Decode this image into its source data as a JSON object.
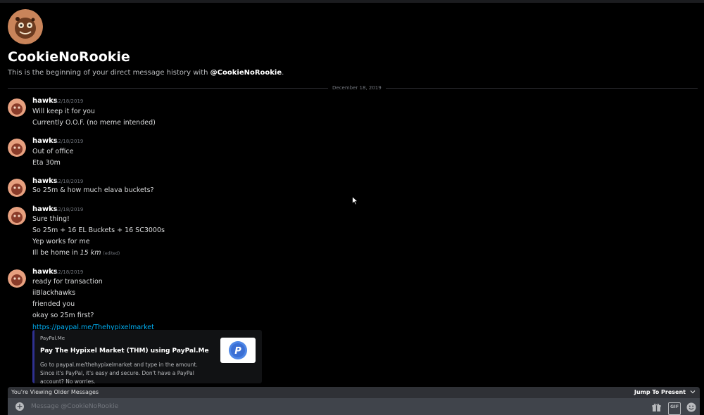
{
  "channel": {
    "name": "CookieNoRookie",
    "intro_prefix": "This is the beginning of your direct message history with ",
    "intro_mention": "@CookieNoRookie",
    "intro_suffix": "."
  },
  "date_divider": "December 18, 2019",
  "messages": [
    {
      "author": "hawks",
      "timestamp": "12/18/2019",
      "lines": [
        "Will keep it for you",
        "Currently O.O.F. (no meme intended)"
      ]
    },
    {
      "author": "hawks",
      "timestamp": "12/18/2019",
      "lines": [
        "Out of office",
        "Eta 30m"
      ]
    },
    {
      "author": "hawks",
      "timestamp": "12/18/2019",
      "lines": [
        "So 25m & how much elava buckets?"
      ]
    },
    {
      "author": "hawks",
      "timestamp": "12/18/2019",
      "lines": [
        "Sure thing!",
        "So 25m + 16 EL Buckets + 16 SC3000s",
        "Yep works for me",
        "Ill be home in "
      ],
      "emphasis": "15 km",
      "edited": "(edited)"
    },
    {
      "author": "hawks",
      "timestamp": "12/18/2019",
      "lines": [
        "ready for transaction",
        "iiBlackhawks",
        "friended you",
        "okay so 25m first?"
      ],
      "link": "https://paypal.me/Thehypixelmarket"
    }
  ],
  "embed": {
    "provider": "PayPal.Me",
    "title": "Pay The Hypixel Market (THM) using PayPal.Me",
    "description": "Go to paypal.me/thehypixelmarket and type in the amount. Since it's PayPal, it's easy and secure. Don't have a PayPal account? No worries."
  },
  "older_bar": {
    "label": "You're Viewing Older Messages",
    "jump_label": "Jump To Present"
  },
  "composer": {
    "placeholder": "Message @CookieNoRookie",
    "gif_label": "GIF"
  },
  "colors": {
    "background": "#000000",
    "link": "#00b0f4",
    "embed_border": "#2f3190",
    "composer": "#40444b",
    "older_bar": "#2f3136"
  }
}
